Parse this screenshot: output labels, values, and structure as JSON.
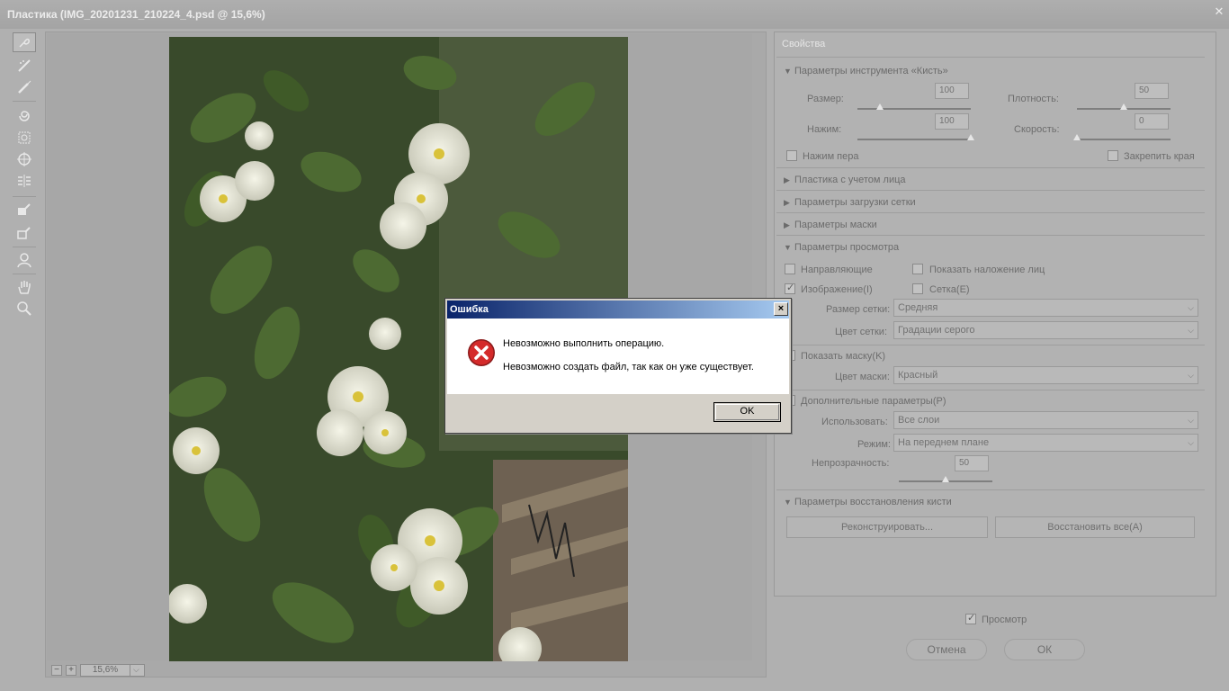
{
  "window": {
    "title": "Пластика (IMG_20201231_210224_4.psd @ 15,6%)",
    "close_symbol": "✕"
  },
  "toolbar": {
    "tools": [
      {
        "name": "forward-warp-tool-icon"
      },
      {
        "name": "reconstruct-tool-icon"
      },
      {
        "name": "smooth-tool-icon"
      },
      {
        "name": "twirl-clockwise-tool-icon"
      },
      {
        "name": "pucker-tool-icon"
      },
      {
        "name": "bloat-tool-icon"
      },
      {
        "name": "push-left-tool-icon"
      },
      {
        "name": "freeze-mask-tool-icon"
      },
      {
        "name": "thaw-mask-tool-icon"
      },
      {
        "name": "face-tool-icon"
      },
      {
        "name": "hand-tool-icon"
      },
      {
        "name": "zoom-tool-icon"
      }
    ]
  },
  "zoom": {
    "minus": "−",
    "plus": "+",
    "value": "15,6%"
  },
  "properties": {
    "title": "Свойства",
    "brush_section": "Параметры инструмента «Кисть»",
    "size_label": "Размер:",
    "size_value": "100",
    "size_level": 0.2,
    "density_label": "Плотность:",
    "density_value": "50",
    "density_level": 0.5,
    "pressure_label": "Нажим:",
    "pressure_value": "100",
    "pressure_level": 1.0,
    "rate_label": "Скорость:",
    "rate_value": "0",
    "rate_level": 0.0,
    "pen_pressure_label": "Нажим пера",
    "pin_edges_label": "Закрепить края",
    "face_section": "Пластика с учетом лица",
    "mesh_load_section": "Параметры загрузки сетки",
    "mask_section": "Параметры маски",
    "view_section": "Параметры просмотра",
    "guides_label": "Направляющие",
    "face_overlay_label": "Показать наложение лиц",
    "image_label": "Изображение(I)",
    "mesh_label": "Сетка(E)",
    "mesh_size_label": "Размер сетки:",
    "mesh_size_value": "Средняя",
    "mesh_color_label": "Цвет сетки:",
    "mesh_color_value": "Градации серого",
    "show_mask_label": "Показать маску(K)",
    "mask_color_label": "Цвет маски:",
    "mask_color_value": "Красный",
    "extra_label": "Дополнительные параметры(P)",
    "use_label": "Использовать:",
    "use_value": "Все слои",
    "mode_label": "Режим:",
    "mode_value": "На переднем плане",
    "opacity_label": "Непрозрачность:",
    "opacity_value": "50",
    "opacity_level": 0.5,
    "restore_section": "Параметры восстановления кисти",
    "reconstruct_button": "Реконструировать...",
    "restore_all_button": "Восстановить все(A)"
  },
  "footer": {
    "preview_label": "Просмотр",
    "cancel_button": "Отмена",
    "ok_button": "ОК"
  },
  "dialog": {
    "title": "Ошибка",
    "close_symbol": "×",
    "message1": "Невозможно выполнить операцию.",
    "message2": "Невозможно создать файл, так как он уже существует.",
    "ok_button": "OK"
  },
  "colors": {
    "dialog_title_start": "#0a246a",
    "dialog_title_end": "#a6caf0",
    "error_red": "#d42a2a"
  }
}
